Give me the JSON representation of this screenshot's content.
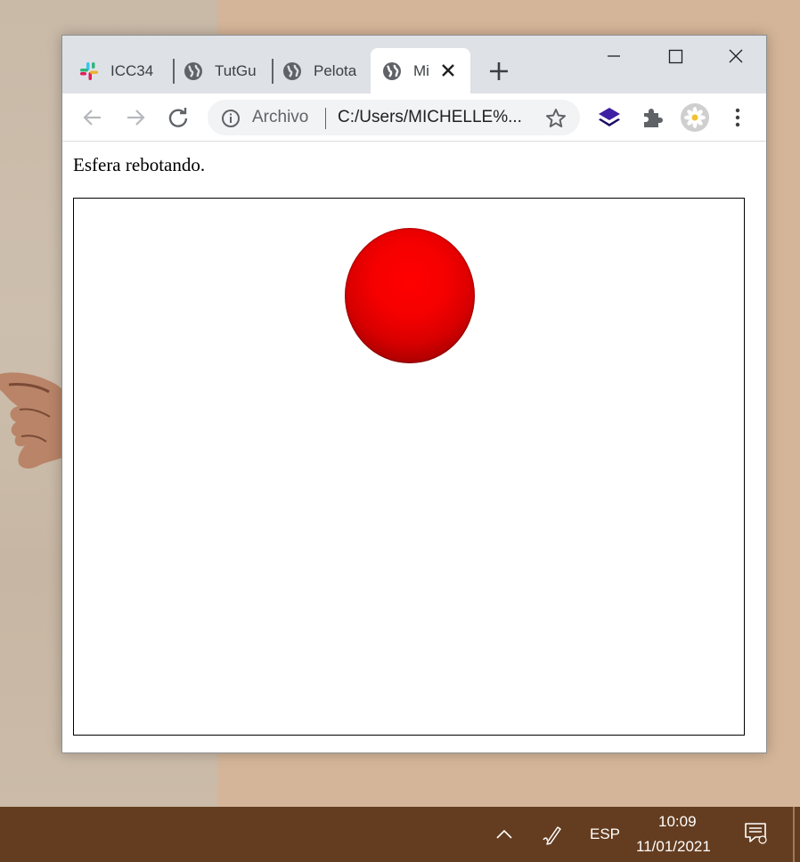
{
  "browser": {
    "tabs": [
      {
        "title": "ICC34",
        "icon": "slack-icon",
        "active": false
      },
      {
        "title": "TutGu",
        "icon": "globe-icon",
        "active": false
      },
      {
        "title": "Pelota",
        "icon": "globe-icon",
        "active": false
      },
      {
        "title": "Mi",
        "icon": "globe-icon",
        "active": true
      }
    ],
    "omnibox": {
      "scheme_label": "Archivo",
      "url": "C:/Users/MICHELLE%..."
    },
    "accent": "#dee1e6"
  },
  "page": {
    "heading": "Esfera rebotando.",
    "sphere_color": "#ff0000"
  },
  "taskbar": {
    "language": "ESP",
    "time": "10:09",
    "date": "11/01/2021",
    "color": "#643d20"
  }
}
